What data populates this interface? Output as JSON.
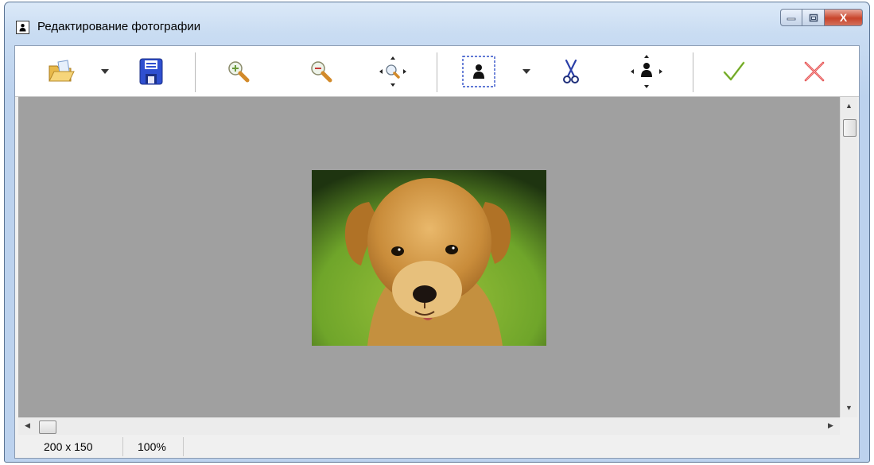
{
  "window": {
    "title": "Редактирование фотографии",
    "close_glyph": "X"
  },
  "toolbar": {
    "buttons": [
      {
        "name": "open-button",
        "icon": "open-folder-icon"
      },
      {
        "name": "open-dropdown-button",
        "icon": "chevron-down-icon"
      },
      {
        "name": "save-button",
        "icon": "floppy-disk-icon"
      },
      {
        "name": "zoom-in-button",
        "icon": "zoom-in-icon"
      },
      {
        "name": "zoom-out-button",
        "icon": "zoom-out-icon"
      },
      {
        "name": "fit-zoom-button",
        "icon": "zoom-fit-icon"
      },
      {
        "name": "select-area-button",
        "icon": "selection-person-icon"
      },
      {
        "name": "select-dropdown-button",
        "icon": "chevron-down-icon"
      },
      {
        "name": "crop-button",
        "icon": "scissors-icon"
      },
      {
        "name": "move-button",
        "icon": "move-person-icon"
      },
      {
        "name": "accept-button",
        "icon": "check-icon"
      },
      {
        "name": "cancel-button",
        "icon": "cross-icon"
      }
    ]
  },
  "image": {
    "subject": "puppy-photo"
  },
  "status": {
    "dimensions": "200 x 150",
    "zoom": "100%"
  },
  "colors": {
    "save_blue": "#2f4fd0",
    "check_green": "#8fc63f",
    "cancel_red": "#e04a4a",
    "canvas_gray": "#a0a0a0",
    "selection_blue": "#3050c8"
  }
}
